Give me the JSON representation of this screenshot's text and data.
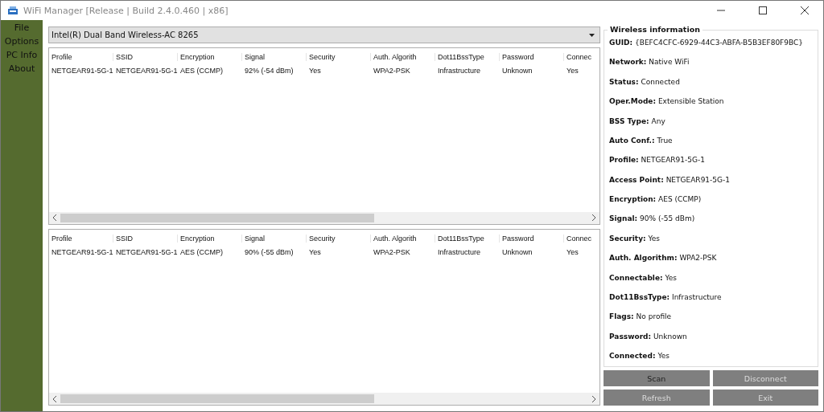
{
  "window": {
    "title": "WiFi Manager [Release | Build 2.4.0.460 | x86]"
  },
  "menu": [
    "File",
    "Options",
    "PC Info",
    "About"
  ],
  "adapter": {
    "value": "Intel(R) Dual Band Wireless-AC 8265"
  },
  "tables": [
    {
      "columns": [
        "Profile",
        "SSID",
        "Encryption",
        "Signal",
        "Security",
        "Auth. Algorith",
        "Dot11BssType",
        "Password",
        "Connec"
      ],
      "rows": [
        [
          "NETGEAR91-5G-1",
          "NETGEAR91-5G-1",
          "AES (CCMP)",
          "92% (-54 dBm)",
          "Yes",
          "WPA2-PSK",
          "Infrastructure",
          "Unknown",
          "Yes"
        ]
      ]
    },
    {
      "columns": [
        "Profile",
        "SSID",
        "Encryption",
        "Signal",
        "Security",
        "Auth. Algorith",
        "Dot11BssType",
        "Password",
        "Connec"
      ],
      "rows": [
        [
          "NETGEAR91-5G-1",
          "NETGEAR91-5G-1",
          "AES (CCMP)",
          "90% (-55 dBm)",
          "Yes",
          "WPA2-PSK",
          "Infrastructure",
          "Unknown",
          "Yes"
        ]
      ]
    }
  ],
  "info": {
    "title": "Wireless information",
    "fields": [
      {
        "label": "GUID:",
        "value": "{BEFC4CFC-6929-44C3-ABFA-B5B3EF80F9BC}"
      },
      {
        "label": "Network:",
        "value": "Native WiFi"
      },
      {
        "label": "Status:",
        "value": "Connected"
      },
      {
        "label": "Oper.Mode:",
        "value": "Extensible Station"
      },
      {
        "label": "BSS Type:",
        "value": "Any"
      },
      {
        "label": "Auto Conf.:",
        "value": "True"
      },
      {
        "label": "Profile:",
        "value": "NETGEAR91-5G-1"
      },
      {
        "label": "Access Point:",
        "value": "NETGEAR91-5G-1"
      },
      {
        "label": "Encryption:",
        "value": "AES (CCMP)"
      },
      {
        "label": "Signal:",
        "value": "90% (-55 dBm)"
      },
      {
        "label": "Security:",
        "value": "Yes"
      },
      {
        "label": "Auth. Algorithm:",
        "value": "WPA2-PSK"
      },
      {
        "label": "Connectable:",
        "value": "Yes"
      },
      {
        "label": "Dot11BssType:",
        "value": "Infrastructure"
      },
      {
        "label": "Flags:",
        "value": "No profile"
      },
      {
        "label": "Password:",
        "value": "Unknown"
      },
      {
        "label": "Connected:",
        "value": "Yes"
      }
    ]
  },
  "buttons": [
    {
      "label": "Scan",
      "focused": true
    },
    {
      "label": "Disconnect",
      "focused": false
    },
    {
      "label": "Refresh",
      "focused": false
    },
    {
      "label": "Exit",
      "focused": false
    }
  ]
}
